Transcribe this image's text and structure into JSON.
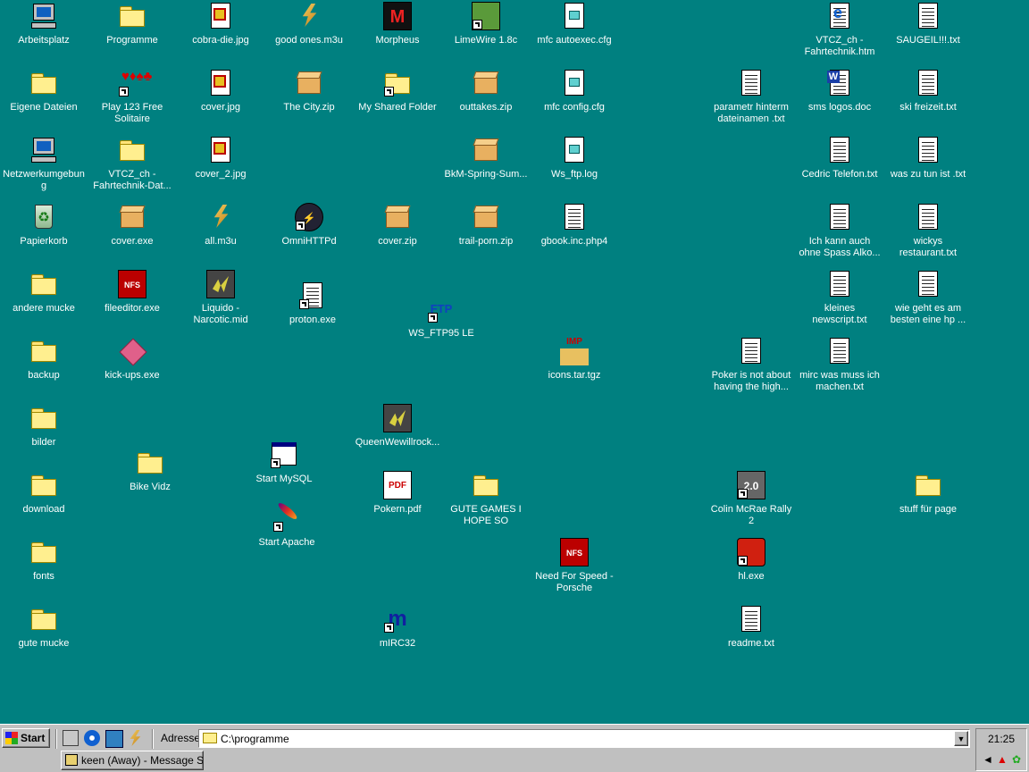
{
  "desktop": {
    "background": "#008080",
    "icons": [
      {
        "label": "Arbeitsplatz",
        "kind": "computer"
      },
      {
        "label": "Programme",
        "kind": "folder"
      },
      {
        "label": "cobra-die.jpg",
        "kind": "image"
      },
      {
        "label": "good ones.m3u",
        "kind": "winamp"
      },
      {
        "label": "Morpheus",
        "kind": "morpheus"
      },
      {
        "label": "LimeWire 1.8c",
        "kind": "limewire"
      },
      {
        "label": "mfc autoexec.cfg",
        "kind": "config"
      },
      {
        "label": "VTCZ_ch - Fahrtechnik.htm",
        "kind": "html"
      },
      {
        "label": "SAUGEIL!!!.txt",
        "kind": "text"
      },
      {
        "label": "Eigene Dateien",
        "kind": "folder-open"
      },
      {
        "label": "Play 123 Free Solitaire",
        "kind": "cards"
      },
      {
        "label": "cover.jpg",
        "kind": "image"
      },
      {
        "label": "The City.zip",
        "kind": "zip"
      },
      {
        "label": "My Shared Folder",
        "kind": "folder"
      },
      {
        "label": "outtakes.zip",
        "kind": "zip"
      },
      {
        "label": "mfc config.cfg",
        "kind": "config"
      },
      {
        "label": "parametr hinterm dateinamen .txt",
        "kind": "text"
      },
      {
        "label": "sms logos.doc",
        "kind": "word"
      },
      {
        "label": "ski freizeit.txt",
        "kind": "text"
      },
      {
        "label": "Netzwerkumgebung",
        "kind": "network"
      },
      {
        "label": "VTCZ_ch - Fahrtechnik-Dat...",
        "kind": "folder"
      },
      {
        "label": "cover_2.jpg",
        "kind": "image"
      },
      {
        "label": "BkM-Spring-Sum...",
        "kind": "zip"
      },
      {
        "label": "Ws_ftp.log",
        "kind": "config"
      },
      {
        "label": "Cedric Telefon.txt",
        "kind": "text"
      },
      {
        "label": "was zu tun ist .txt",
        "kind": "text"
      },
      {
        "label": "Papierkorb",
        "kind": "recycle"
      },
      {
        "label": "cover.exe",
        "kind": "zipexe"
      },
      {
        "label": "all.m3u",
        "kind": "winamp"
      },
      {
        "label": "OmniHTTPd",
        "kind": "omni"
      },
      {
        "label": "cover.zip",
        "kind": "zip"
      },
      {
        "label": "trail-porn.zip",
        "kind": "zip"
      },
      {
        "label": "gbook.inc.php4",
        "kind": "php"
      },
      {
        "label": "Ich kann auch ohne Spass Alko...",
        "kind": "text"
      },
      {
        "label": "wickys restaurant.txt",
        "kind": "text"
      },
      {
        "label": "andere mucke",
        "kind": "folder"
      },
      {
        "label": "fileeditor.exe",
        "kind": "nfs"
      },
      {
        "label": "Liquido - Narcotic.mid",
        "kind": "midi"
      },
      {
        "label": "proton.exe",
        "kind": "proton"
      },
      {
        "label": "WS_FTP95 LE",
        "kind": "ftp"
      },
      {
        "label": "kleines newscript.txt",
        "kind": "text"
      },
      {
        "label": "wie geht es am besten eine hp ...",
        "kind": "text"
      },
      {
        "label": "backup",
        "kind": "folder"
      },
      {
        "label": "kick-ups.exe",
        "kind": "kickups"
      },
      {
        "label": "icons.tar.tgz",
        "kind": "tgz"
      },
      {
        "label": "Poker is not about having the high...",
        "kind": "text"
      },
      {
        "label": "mirc was muss ich machen.txt",
        "kind": "text"
      },
      {
        "label": "bilder",
        "kind": "folder"
      },
      {
        "label": "QueenWewillrock...",
        "kind": "midi"
      },
      {
        "label": "Bike Vidz",
        "kind": "folder"
      },
      {
        "label": "Start MySQL",
        "kind": "window"
      },
      {
        "label": "download",
        "kind": "folder"
      },
      {
        "label": "Pokern.pdf",
        "kind": "pdf"
      },
      {
        "label": "GUTE GAMES I HOPE SO",
        "kind": "folder"
      },
      {
        "label": "Colin McRae Rally 2",
        "kind": "rally"
      },
      {
        "label": "stuff für page",
        "kind": "folder"
      },
      {
        "label": "Start Apache",
        "kind": "apache"
      },
      {
        "label": "fonts",
        "kind": "folder"
      },
      {
        "label": "Need For Speed - Porsche",
        "kind": "nfs"
      },
      {
        "label": "hl.exe",
        "kind": "halflife"
      },
      {
        "label": "gute mucke",
        "kind": "folder"
      },
      {
        "label": "mIRC32",
        "kind": "mirc"
      },
      {
        "label": "readme.txt",
        "kind": "text"
      }
    ]
  },
  "glyphs": {
    "cards": "♥♦♠♣",
    "morpheus": "M",
    "nfs": "NFS",
    "ftp": "FTP",
    "tgz": "IMP",
    "pdf": "PDF",
    "rally": "2.0",
    "mirc": "m",
    "word": "W",
    "html": "e",
    "omni": "⚡",
    "zipexe": "ZIP"
  },
  "taskbar": {
    "start_label": "Start",
    "address_label": "Adresse",
    "address_value": "C:\\programme",
    "address_dropdown_glyph": "▼",
    "clock": "21:25",
    "task_button_label": "keen (Away) - Message Se...",
    "quicklaunch": [
      "show-desktop-icon",
      "internet-explorer-icon",
      "channels-icon",
      "winamp-icon"
    ],
    "tray": [
      "speaker-icon",
      "alert-icon",
      "icq-icon"
    ]
  },
  "colors": {
    "desktop": "#008080",
    "taskbar": "#c0c0c0",
    "label_text": "#ffffff"
  }
}
